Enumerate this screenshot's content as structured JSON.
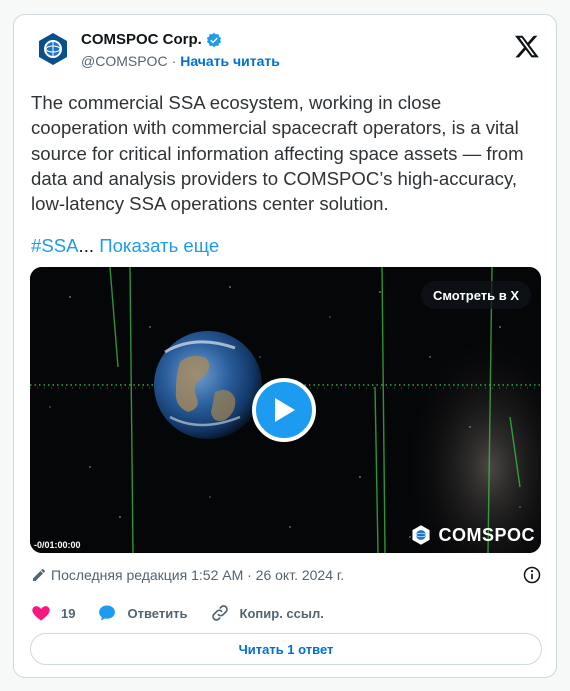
{
  "author": {
    "name": "COMSPOC Corp.",
    "handle": "@COMSPOC",
    "separator": "·",
    "follow_label": "Начать читать"
  },
  "tweet": {
    "text": "The commercial SSA ecosystem, working in close cooperation with commercial spacecraft operators, is a vital source for critical information affecting space assets — from data and analysis providers to COMSPOC’s high-accuracy, low-latency SSA operations center solution.",
    "hashtag": "#SSA",
    "ellipsis": "...",
    "show_more": "Показать еще"
  },
  "media": {
    "watch_label": "Смотреть в X",
    "timecode": "-0/01:00:00",
    "brand": "COMSPOC"
  },
  "meta": {
    "edited_label": "Последняя редакция 1:52 AM · 26 окт. 2024 г."
  },
  "actions": {
    "like_count": "19",
    "reply_label": "Ответить",
    "copy_link_label": "Копир. ссыл."
  },
  "read_replies_label": "Читать 1 ответ",
  "colors": {
    "accent": "#1d9bf0",
    "like": "#f91880",
    "muted": "#536471"
  },
  "icons": {
    "verified": "verified-badge-icon",
    "x_logo": "x-logo-icon",
    "play": "play-icon",
    "pencil": "pencil-icon",
    "info": "info-icon",
    "heart": "heart-icon",
    "reply": "reply-bubble-icon",
    "link": "link-icon"
  }
}
